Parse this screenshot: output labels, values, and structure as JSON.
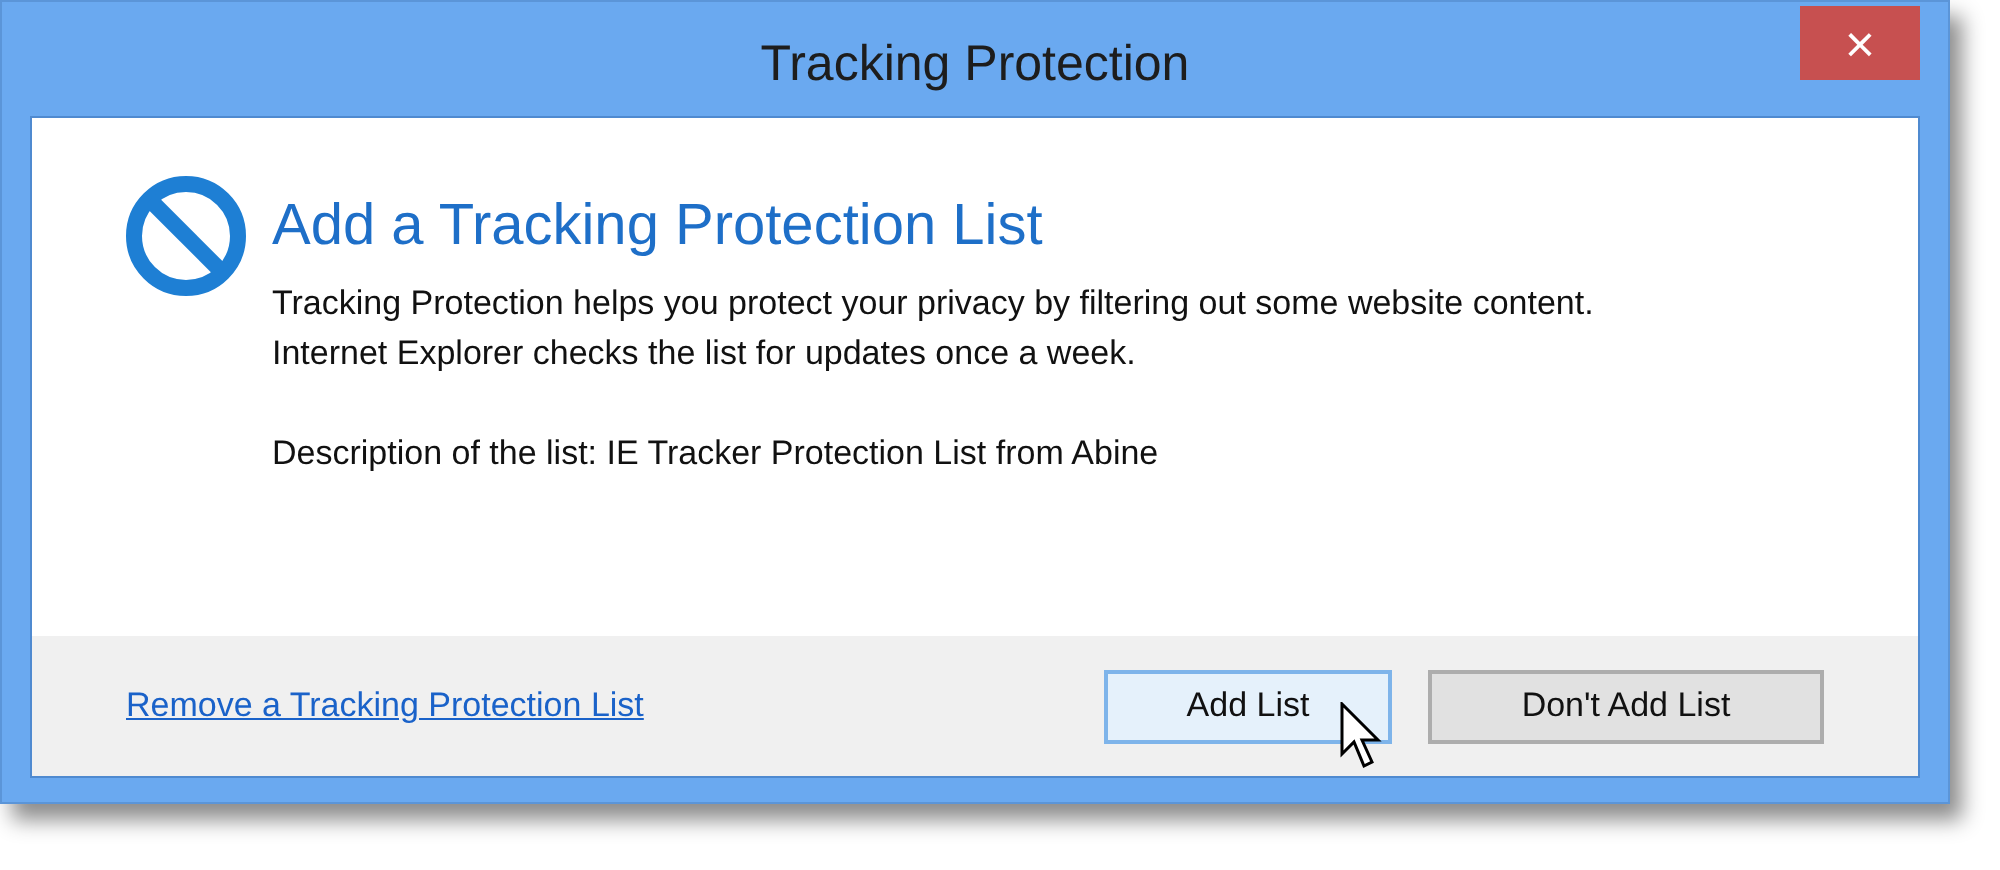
{
  "window": {
    "title": "Tracking Protection",
    "close_button": "×"
  },
  "heading": "Add a Tracking Protection List",
  "description": "Tracking Protection helps you protect your privacy by filtering out some website content. Internet Explorer checks the list for updates once a week.",
  "list_description": "Description of the list: IE Tracker Protection List from Abine",
  "footer": {
    "link": "Remove a Tracking Protection List",
    "buttons": [
      {
        "label": "Add List",
        "highlighted": true
      },
      {
        "label": "Don't Add List",
        "highlighted": false
      }
    ]
  }
}
